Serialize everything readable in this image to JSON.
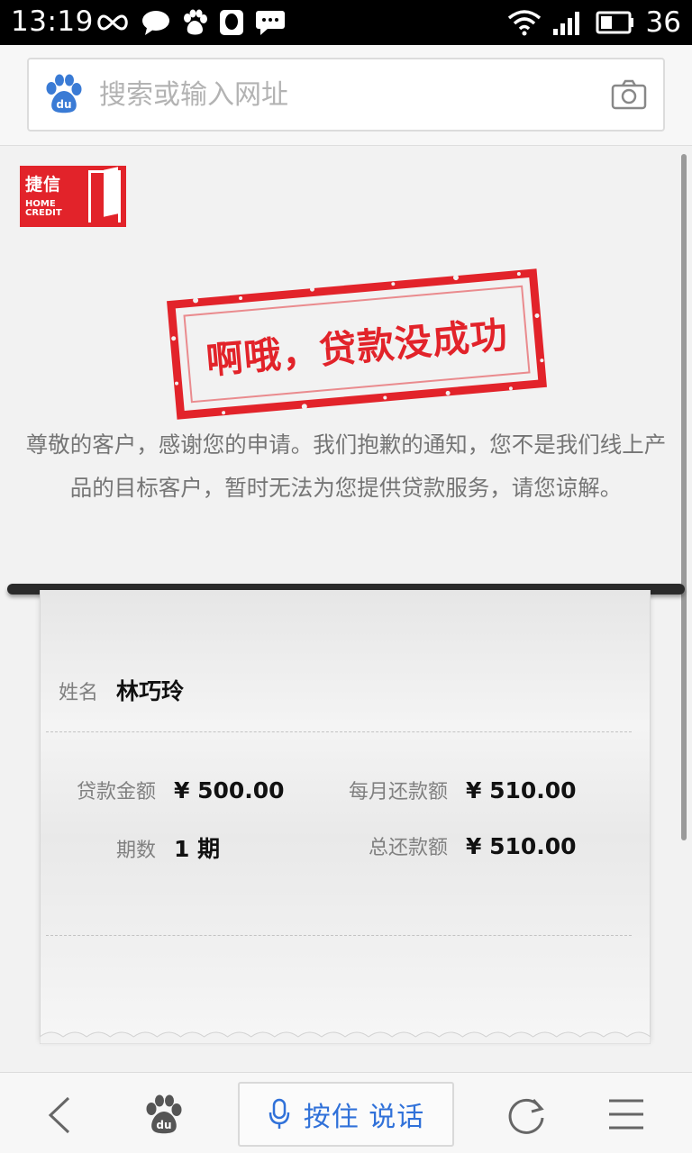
{
  "status_bar": {
    "time": "13:19",
    "battery_level": "36"
  },
  "address_bar": {
    "placeholder": "搜索或输入网址"
  },
  "brand": {
    "name_cn": "捷信",
    "name_en_line1": "HOME",
    "name_en_line2": "CREDIT"
  },
  "stamp": {
    "text": "啊哦，贷款没成功"
  },
  "message": "尊敬的客户，感谢您的申请。我们抱歉的通知，您不是我们线上产品的目标客户，暂时无法为您提供贷款服务，请您谅解。",
  "receipt": {
    "name_label": "姓名",
    "name_value": "林巧玲",
    "loan_amount_label": "贷款金额",
    "loan_amount_value": "¥ 500.00",
    "monthly_label": "每月还款额",
    "monthly_value": "¥ 510.00",
    "term_label": "期数",
    "term_value": "1 期",
    "total_label": "总还款额",
    "total_value": "¥ 510.00"
  },
  "bottom_bar": {
    "voice_label": "按住 说话"
  },
  "colors": {
    "brand_red": "#e2232a",
    "voice_blue": "#3071d9"
  }
}
